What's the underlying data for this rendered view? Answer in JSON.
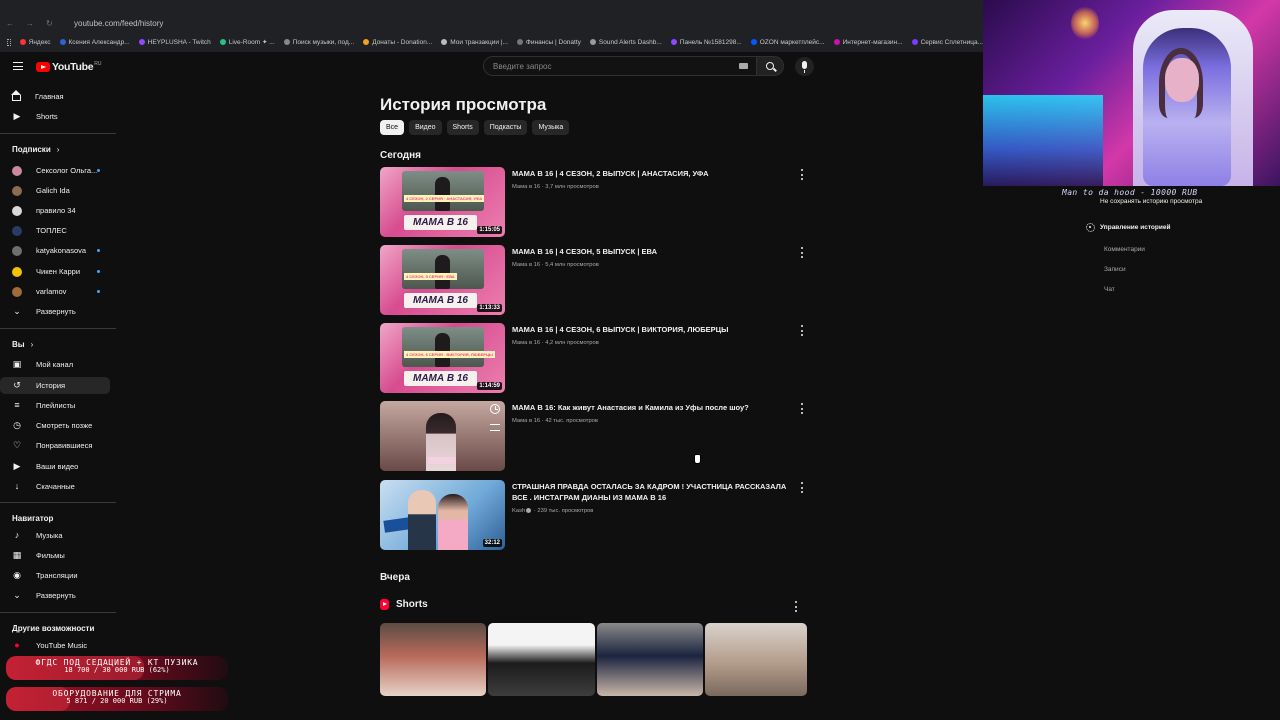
{
  "browser": {
    "url": "youtube.com/feed/history",
    "bookmarks": [
      {
        "label": "Яндекс",
        "color": "#ff3333"
      },
      {
        "label": "Ксения Александр...",
        "color": "#2a63d5"
      },
      {
        "label": "HEYPLUSHA - Twitch",
        "color": "#9146ff"
      },
      {
        "label": "Live-Room ✦ ...",
        "color": "#26c281"
      },
      {
        "label": "Поиск музыки, под...",
        "color": "#888888"
      },
      {
        "label": "Донаты - Donation...",
        "color": "#f4a21c"
      },
      {
        "label": "Мои транзакции |...",
        "color": "#bbbbbb"
      },
      {
        "label": "Финансы | Donatty",
        "color": "#777777"
      },
      {
        "label": "Sound Alerts Dashb...",
        "color": "#999999"
      },
      {
        "label": "Панель №1581298...",
        "color": "#9146ff"
      },
      {
        "label": "OZON маркетплейс...",
        "color": "#005bff"
      },
      {
        "label": "Интернет-магазин...",
        "color": "#cb11ab"
      },
      {
        "label": "Сервис Сплетница...",
        "color": "#7a3cff"
      }
    ]
  },
  "header": {
    "logo_text": "YouTube",
    "logo_region": "RU",
    "search_placeholder": "Введите запрос"
  },
  "sidebar": {
    "main": [
      {
        "label": "Главная",
        "icon": "home-icon"
      },
      {
        "label": "Shorts",
        "icon": "shorts-icon"
      }
    ],
    "subscriptions_title": "Подписки",
    "subscriptions": [
      {
        "label": "Сексолог Ольга...",
        "color": "#c98aa0"
      },
      {
        "label": "Galich Ida",
        "color": "#8a6b55"
      },
      {
        "label": "правило 34",
        "color": "#d8d8d8"
      },
      {
        "label": "ТОПЛЕС",
        "color": "#2a3b66"
      },
      {
        "label": "katyakonasova",
        "color": "#6e6e6e"
      },
      {
        "label": "Чикен Карри",
        "color": "#f2c200"
      },
      {
        "label": "varlamov",
        "color": "#a06a3a"
      }
    ],
    "subscriptions_expand": "Развернуть",
    "you_title": "Вы",
    "you": [
      {
        "label": "Мой канал",
        "icon": "channel-icon"
      },
      {
        "label": "История",
        "icon": "history-icon"
      },
      {
        "label": "Плейлисты",
        "icon": "playlists-icon"
      },
      {
        "label": "Смотреть позже",
        "icon": "watch-later-icon"
      },
      {
        "label": "Понравившиеся",
        "icon": "like-icon"
      },
      {
        "label": "Ваши видео",
        "icon": "your-videos-icon"
      },
      {
        "label": "Скачанные",
        "icon": "download-icon"
      }
    ],
    "navigator_title": "Навигатор",
    "navigator": [
      {
        "label": "Музыка",
        "icon": "music-icon"
      },
      {
        "label": "Фильмы",
        "icon": "film-icon"
      },
      {
        "label": "Трансляции",
        "icon": "live-icon"
      },
      {
        "label": "Развернуть",
        "icon": "chevron-down-icon"
      }
    ],
    "other_title": "Другие возможности",
    "other": [
      {
        "label": "YouTube Music",
        "icon": "youtube-music-icon"
      }
    ]
  },
  "main": {
    "title": "История просмотра",
    "chips": [
      "Все",
      "Видео",
      "Shorts",
      "Подкасты",
      "Музыка"
    ],
    "today_label": "Сегодня",
    "yesterday_label": "Вчера",
    "shorts_label": "Shorts",
    "videos": [
      {
        "title": "МАМА В 16 | 4 СЕЗОН, 2 ВЫПУСК | АНАСТАСИЯ, УФА",
        "meta": "Мама в 16 · 3,7 млн просмотров",
        "duration": "1:15:05",
        "thumb_brand": "МАМА В 16",
        "thumb_tag": "4 СЕЗОН, 2 СЕРИЯ · АНАСТАСИЯ, УФА"
      },
      {
        "title": "МАМА В 16 | 4 СЕЗОН, 5 ВЫПУСК | ЕВА",
        "meta": "Мама в 16 · 5,4 млн просмотров",
        "duration": "1:13:33",
        "thumb_brand": "МАМА В 16",
        "thumb_tag": "4 СЕЗОН, 5 СЕРИЯ · ЕВА"
      },
      {
        "title": "МАМА В 16 | 4 СЕЗОН, 6 ВЫПУСК | ВИКТОРИЯ, ЛЮБЕРЦЫ",
        "meta": "Мама в 16 · 4,2 млн просмотров",
        "duration": "1:14:59",
        "thumb_brand": "МАМА В 16",
        "thumb_tag": "4 СЕЗОН, 6 СЕРИЯ · ВИКТОРИЯ, ЛЮБЕРЦЫ"
      },
      {
        "title": "МАМА В 16: Как живут Анастасия и Камила из Уфы после шоу?",
        "meta": "Мама в 16 · 42 тыс. просмотров",
        "duration": "",
        "thumb_brand": "",
        "thumb_tag": ""
      },
      {
        "title": "СТРАШНАЯ ПРАВДА ОСТАЛАСЬ ЗА КАДРОМ ! УЧАСТНИЦА РАССКАЗАЛА ВСЕ . ИНСТАГРАМ ДИАНЫ ИЗ МАМА В 16",
        "channel": "Kash",
        "views": "239 тыс. просмотров",
        "duration": "32:12",
        "thumb_brand": "",
        "thumb_tag": ""
      }
    ]
  },
  "history_panel": {
    "pause_history": "Не сохранять историю просмотра",
    "manage": "Управление историей",
    "items": [
      "Комментарии",
      "Записи",
      "Чат"
    ]
  },
  "overlay": {
    "donation_text": "Man to da hood - 10000 RUB",
    "goals": [
      {
        "title": "ФГДС ПОД СЕДАЦИЕЙ + КТ ПУЗИКА",
        "amount": "18 700 / 30 000 RUB (62%)",
        "progress": 0.62
      },
      {
        "title": "ОБОРУДОВАНИЕ ДЛЯ СТРИМА",
        "amount": "5 871 / 20 000 RUB (29%)",
        "progress": 0.29
      }
    ]
  },
  "colors": {
    "background": "#0f0f0f",
    "text": "#f1f1f1",
    "secondary_text": "#aaaaaa",
    "accent_red": "#ff0000",
    "live_blue": "#3ea6ff"
  }
}
